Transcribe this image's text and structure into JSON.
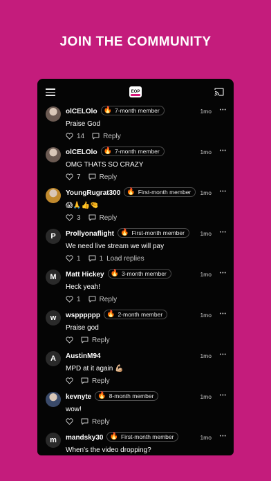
{
  "headline": "JOIN THE COMMUNITY",
  "app": {
    "logo_text": "EOP"
  },
  "comments": [
    {
      "username": "olCELOlo",
      "badge": "7-month member",
      "time": "1mo",
      "text": "Praise God",
      "likes": "14",
      "reply_count": "",
      "reply_label": "Reply",
      "avatar": "photo",
      "avatar_color": "#6b5a52"
    },
    {
      "username": "olCELOlo",
      "badge": "7-month member",
      "time": "1mo",
      "text": "OMG THATS SO CRAZY",
      "likes": "7",
      "reply_count": "",
      "reply_label": "Reply",
      "avatar": "photo",
      "avatar_color": "#6b5a52"
    },
    {
      "username": "YoungRugrat300",
      "badge": "First-month member",
      "time": "1mo",
      "text": "😱🙏👍🤏",
      "likes": "3",
      "reply_count": "",
      "reply_label": "Reply",
      "avatar": "photo",
      "avatar_color": "#c18a2e"
    },
    {
      "username": "Prollyonaflight",
      "badge": "First-month member",
      "time": "1mo",
      "text": "We need live stream we will pay",
      "likes": "1",
      "reply_count": "1",
      "reply_label": "Load replies",
      "avatar": "P",
      "avatar_color": "#2a2a2a"
    },
    {
      "username": "Matt Hickey",
      "badge": "3-month member",
      "time": "1mo",
      "text": "Heck yeah!",
      "likes": "1",
      "reply_count": "",
      "reply_label": "Reply",
      "avatar": "M",
      "avatar_color": "#2a2a2a"
    },
    {
      "username": "wspppppp",
      "badge": "2-month member",
      "time": "1mo",
      "text": "Praise god",
      "likes": "",
      "reply_count": "",
      "reply_label": "Reply",
      "avatar": "w",
      "avatar_color": "#2a2a2a"
    },
    {
      "username": "AustinM94",
      "badge": "",
      "time": "1mo",
      "text": "MPD at it again 💪🏼",
      "likes": "",
      "reply_count": "",
      "reply_label": "Reply",
      "avatar": "A",
      "avatar_color": "#2a2a2a"
    },
    {
      "username": "kevnyte",
      "badge": "8-month member",
      "time": "1mo",
      "text": "wow!",
      "likes": "",
      "reply_count": "",
      "reply_label": "Reply",
      "avatar": "photo",
      "avatar_color": "#3a4a6a"
    },
    {
      "username": "mandsky30",
      "badge": "First-month member",
      "time": "1mo",
      "text": "When's the video dropping?",
      "likes": "",
      "reply_count": "",
      "reply_label": "Reply",
      "avatar": "m",
      "avatar_color": "#2a2a2a"
    }
  ]
}
